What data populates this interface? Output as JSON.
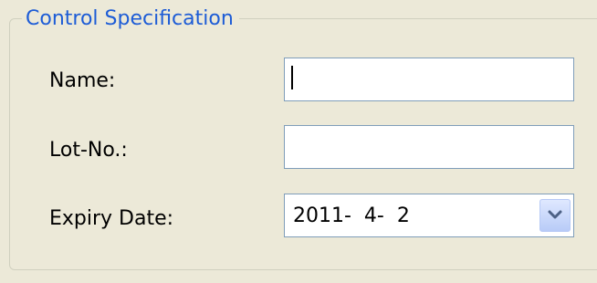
{
  "group": {
    "title": "Control Specification"
  },
  "fields": {
    "name": {
      "label": "Name:",
      "value": ""
    },
    "lot_no": {
      "label": "Lot-No.:",
      "value": ""
    },
    "expiry_date": {
      "label": "Expiry Date:",
      "value": "2011-  4-  2"
    }
  },
  "colors": {
    "title": "#1d5cd6",
    "background": "#ece9d8",
    "input_border": "#7f9db9",
    "dropdown_button": "#b8cbf7",
    "chevron": "#4d6185"
  },
  "icons": {
    "dropdown": "chevron-down-icon"
  }
}
